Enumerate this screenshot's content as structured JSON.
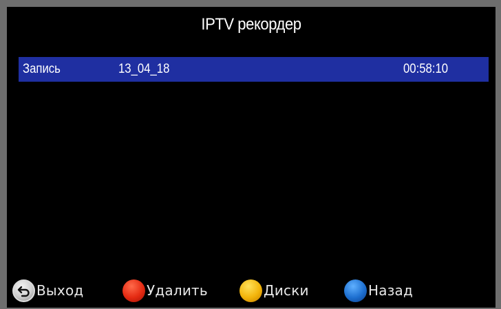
{
  "header": {
    "title": "IPTV рекордер"
  },
  "recordings": [
    {
      "name": "Запись",
      "date": "13_04_18",
      "duration": "00:58:10"
    }
  ],
  "footer": {
    "exit": {
      "label": "Выход",
      "icon": "return-arrow-icon",
      "color": "#d0d0d0"
    },
    "delete": {
      "label": "Удалить",
      "icon": "red-button-icon",
      "color": "#e42a12"
    },
    "disks": {
      "label": "Диски",
      "icon": "yellow-button-icon",
      "color": "#f2b40a"
    },
    "back": {
      "label": "Назад",
      "icon": "blue-button-icon",
      "color": "#1d6fd0"
    }
  },
  "colors": {
    "background": "#000000",
    "selection": "#1f2fa1",
    "frame": "#6e6e6e"
  }
}
